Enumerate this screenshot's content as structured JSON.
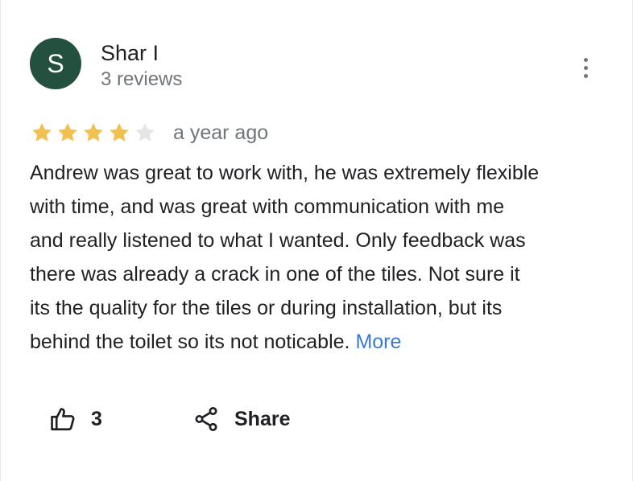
{
  "author": {
    "initial": "S",
    "name": "Shar I",
    "review_count": "3 reviews",
    "avatar_color": "#24503f"
  },
  "menu": {
    "icon": "more-vert-icon"
  },
  "rating": {
    "stars": 4,
    "max_stars": 5,
    "filled_color": "#f1c04f",
    "empty_color": "#e6e6e6",
    "date": "a year ago"
  },
  "review": {
    "lines": [
      "Andrew was great to work with, he was extremely flexible",
      "with time, and was great with communication with me",
      "and really listened to what I wanted. Only feedback was",
      "there was already a crack in one of the tiles. Not sure it",
      "its the quality for the tiles or during installation, but its",
      "behind the toilet so its not noticable."
    ],
    "more_label": "More",
    "link_color": "#3b78d8"
  },
  "actions": {
    "like_icon": "thumb-up-icon",
    "like_count": "3",
    "share_icon": "share-icon",
    "share_label": "Share"
  }
}
